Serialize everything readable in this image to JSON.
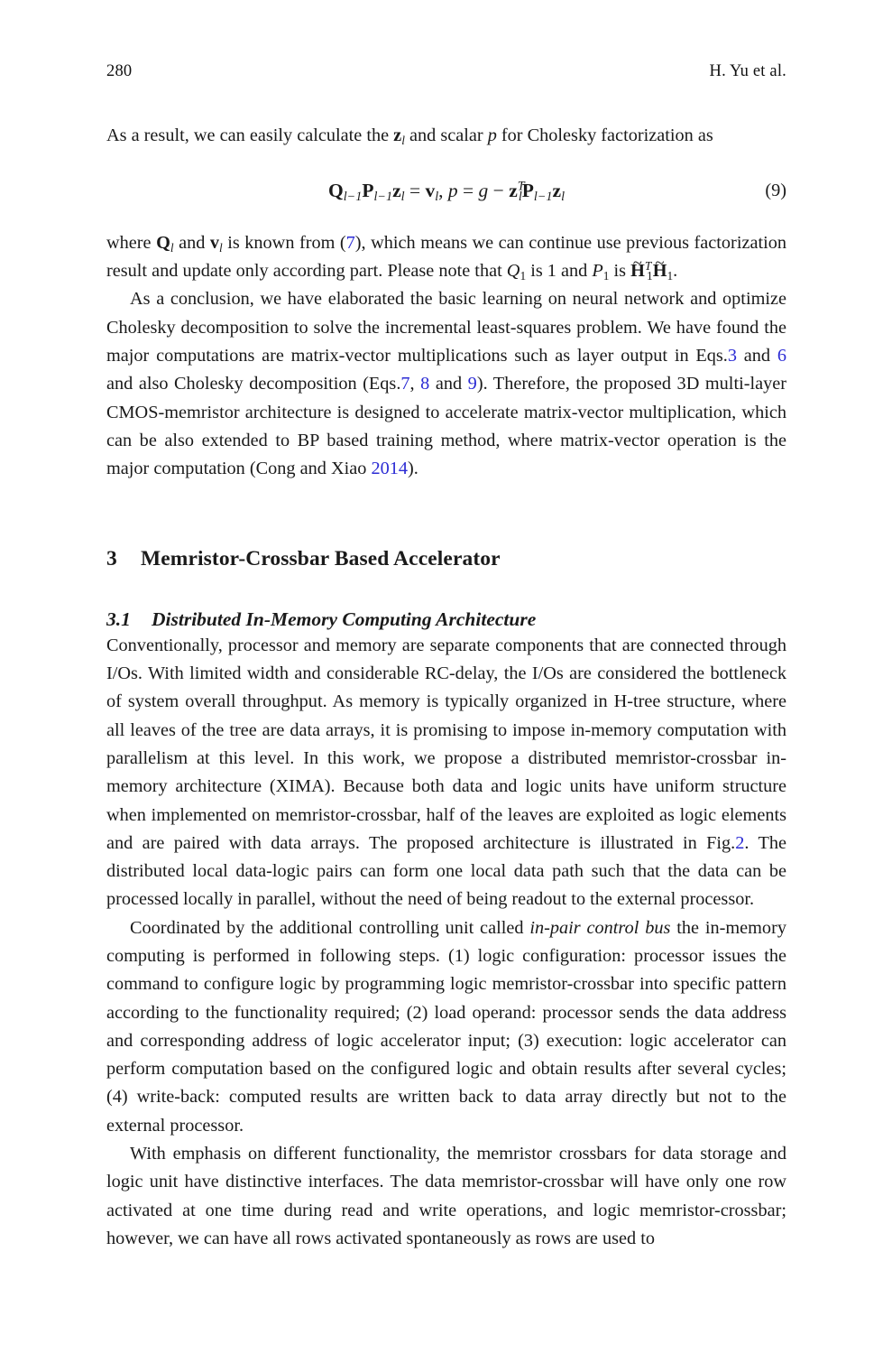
{
  "page": {
    "folio": "280",
    "running_author": "H. Yu et al."
  },
  "intro": {
    "lead_before": "As a result, we can easily calculate the ",
    "lead_z": "z",
    "lead_z_sub": "l",
    "lead_mid": " and scalar ",
    "lead_p": "p",
    "lead_after": " for Cholesky factorization as"
  },
  "equation": {
    "number": "(9)",
    "plain": "Q_{l-1} P_{l-1} z_l = v_l,  p = g - z_l^T P_{l-1} z_l",
    "tokens": {
      "Q": "Q",
      "P": "P",
      "z": "z",
      "v": "v",
      "sub_lm1": "l−1",
      "sub_l": "l",
      "eq": " = ",
      "comma": ", ",
      "p": "p",
      "equals2": " = ",
      "g": "g",
      "minus": " − ",
      "T": "T"
    }
  },
  "para_where": {
    "s1": "where ",
    "Q": "Q",
    "s2": " and ",
    "v": "v",
    "s3": " is known from (",
    "ref7": "7",
    "s4": "), which means we can continue use previous factorization result and update only according part. Please note that ",
    "Q1": "Q",
    "sub1": "1",
    "s5": " is 1 and ",
    "P1": "P",
    "s6": " is ",
    "H": "H",
    "s7": ".",
    "sub_l": "l",
    "tilde": "~",
    "T": "T"
  },
  "para_conclusion": {
    "t1": "As a conclusion, we have elaborated the basic learning on neural network and optimize Cholesky decomposition to solve the incremental least-squares problem. We have found the major computations are matrix-vector multiplications such as layer output in Eqs.",
    "ref3": "3",
    "t2": " and ",
    "ref6": "6",
    "t3": " and also Cholesky decomposition (Eqs.",
    "ref7": "7",
    "t4": ", ",
    "ref8": "8",
    "t5": " and ",
    "ref9": "9",
    "t6": "). Therefore, the proposed 3D multi-layer CMOS-memristor architecture is designed to accelerate matrix-vector multiplication, which can be also extended to BP based training method, where matrix-vector operation is the major computation (Cong and Xiao ",
    "ref2014": "2014",
    "t7": ")."
  },
  "section": {
    "number": "3",
    "title": "Memristor-Crossbar Based Accelerator"
  },
  "subsection": {
    "number": "3.1",
    "title": "Distributed In-Memory Computing Architecture"
  },
  "para_conventionally": {
    "t1": "Conventionally, processor and memory are separate components that are connected through I/Os. With limited width and considerable RC-delay, the I/Os are considered the bottleneck of system overall throughput. As memory is typically organized in H-tree structure, where all leaves of the tree are data arrays, it is promising to impose in-memory computation with parallelism at this level. In this work, we propose a distributed memristor-crossbar in-memory architecture (XIMA). Because both data and logic units have uniform structure when implemented on memristor-crossbar, half of the leaves are exploited as logic elements and are paired with data arrays. The proposed architecture is illustrated in Fig.",
    "ref_fig2": "2",
    "t2": ". The distributed local data-logic pairs can form one local data path such that the data can be processed locally in parallel, without the need of being readout to the external processor."
  },
  "para_coordinated": {
    "t1": "Coordinated by the additional controlling unit called ",
    "em1": "in-pair control bus",
    "t2": " the in-memory computing is performed in following steps. (1) logic configuration: processor issues the command to configure logic by programming logic memristor-crossbar into specific pattern according to the functionality required; (2) load operand: processor sends the data address and corresponding address of logic accelerator input; (3) execution: logic accelerator can perform computation based on the configured logic and obtain results after several cycles; (4) write-back: computed results are written back to data array directly but not to the external processor."
  },
  "para_emphasis": {
    "t1": "With emphasis on different functionality, the memristor crossbars for data storage and logic unit have distinctive interfaces. The data memristor-crossbar will have only one row activated at one time during read and write operations, and logic memristor-crossbar; however, we can have all rows activated spontaneously as rows are used to"
  },
  "colors": {
    "link": "#2b2bd4",
    "text": "#1a1a1a",
    "background": "#ffffff"
  }
}
